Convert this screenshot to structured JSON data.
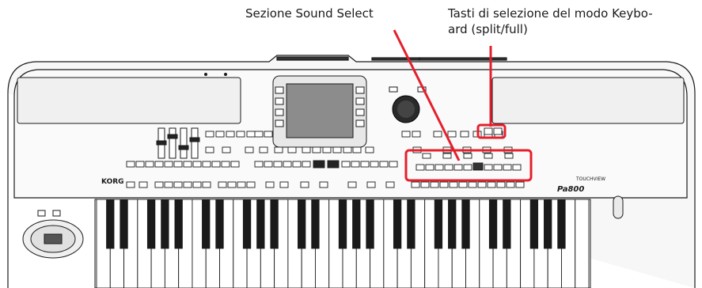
{
  "callouts": {
    "sound_select": "Sezione Sound Select",
    "keyboard_mode_line1": "Tasti di selezione del modo Keybo-",
    "keyboard_mode_line2": "ard (split/full)"
  },
  "keyboard_branding": {
    "brand": "KORG",
    "model": "Pa800",
    "logo_right": "TOUCHVIEW"
  },
  "colors": {
    "callout": "#e4202d",
    "outline": "#1a1a1a",
    "panel": "#f4f4f4"
  },
  "icons": [
    "main-dial-icon",
    "joystick-icon",
    "display-screen-icon"
  ]
}
